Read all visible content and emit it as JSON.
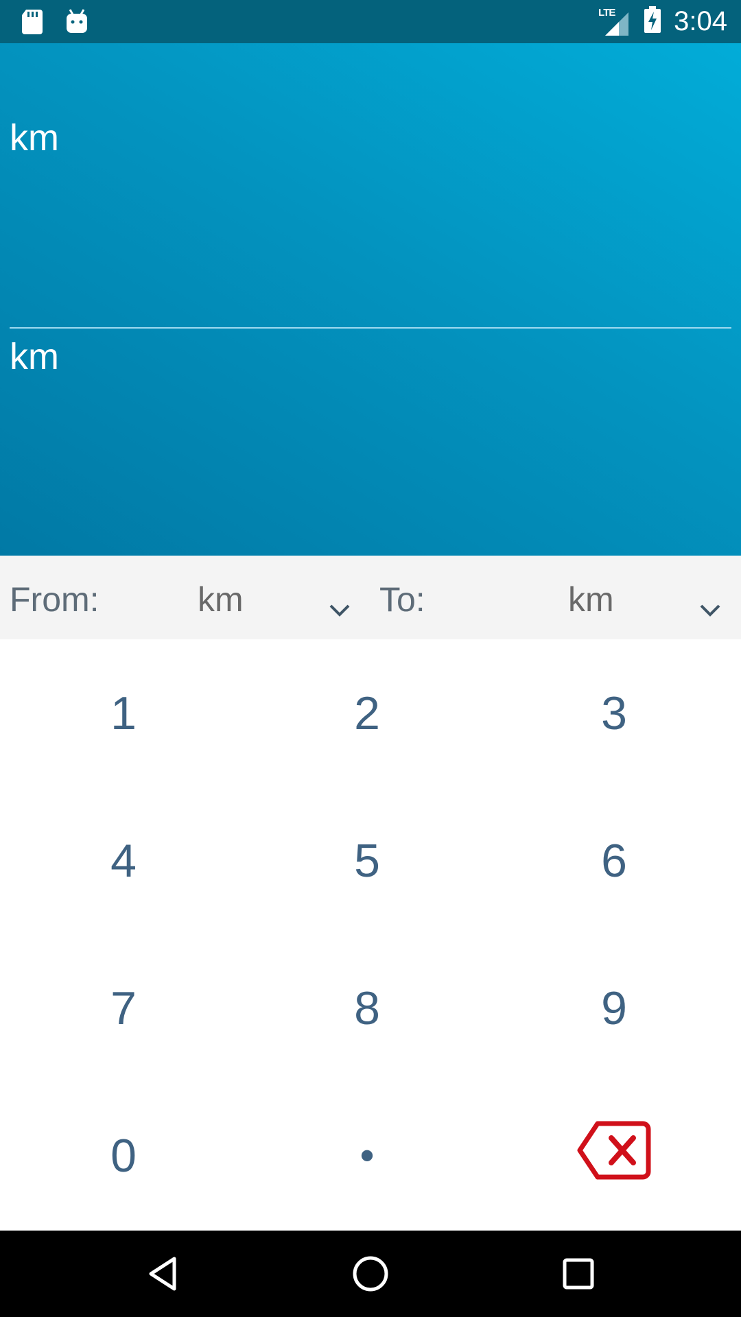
{
  "status_bar": {
    "time": "3:04",
    "network": "LTE",
    "icons": [
      "sd-card-icon",
      "android-icon",
      "lte-signal-icon",
      "battery-charging-icon"
    ]
  },
  "display": {
    "input_unit": "km",
    "output_unit": "km"
  },
  "selector": {
    "from_label": "From:",
    "from_value": "km",
    "to_label": "To:",
    "to_value": "km"
  },
  "keypad": {
    "k1": "1",
    "k2": "2",
    "k3": "3",
    "k4": "4",
    "k5": "5",
    "k6": "6",
    "k7": "7",
    "k8": "8",
    "k9": "9",
    "k0": "0",
    "dot": "•",
    "backspace_icon": "backspace-icon",
    "backspace_color": "#d0101a"
  },
  "colors": {
    "accent": "#0393bf",
    "status_bar": "#04627c",
    "key_text": "#3f6282"
  },
  "nav_bar": {
    "icons": [
      "back-icon",
      "home-icon",
      "recents-icon"
    ]
  }
}
